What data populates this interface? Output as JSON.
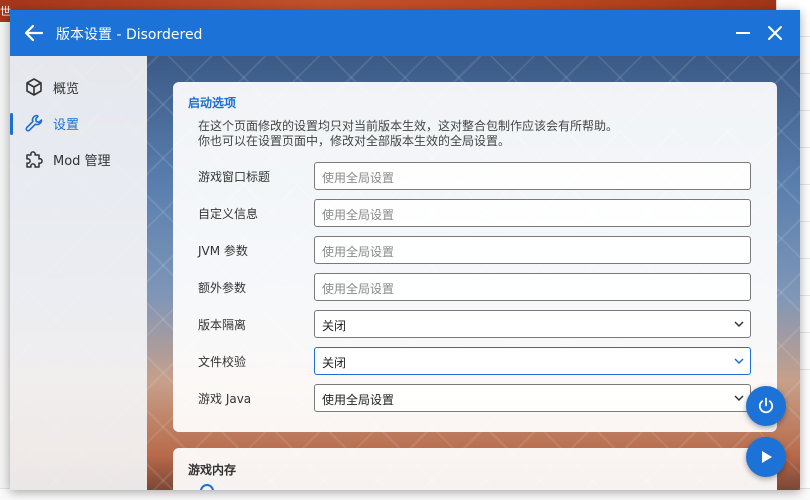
{
  "desktop": {
    "corner_text": "世"
  },
  "window": {
    "title": "版本设置 - Disordered",
    "accent_color": "#1c72d6"
  },
  "sidebar": {
    "items": [
      {
        "label": "概览",
        "icon": "cube-icon",
        "active": false
      },
      {
        "label": "设置",
        "icon": "wrench-icon",
        "active": true
      },
      {
        "label": "Mod 管理",
        "icon": "puzzle-icon",
        "active": false
      }
    ]
  },
  "launch_options": {
    "heading": "启动选项",
    "desc_line1": "在这个页面修改的设置均只对当前版本生效，这对整合包制作应该会有所帮助。",
    "desc_line2": "你也可以在设置页面中，修改对全部版本生效的全局设置。",
    "rows": [
      {
        "label": "游戏窗口标题",
        "placeholder": "使用全局设置",
        "type": "text"
      },
      {
        "label": "自定义信息",
        "placeholder": "使用全局设置",
        "type": "text"
      },
      {
        "label": "JVM 参数",
        "placeholder": "使用全局设置",
        "type": "text"
      },
      {
        "label": "额外参数",
        "placeholder": "使用全局设置",
        "type": "text"
      },
      {
        "label": "版本隔离",
        "value": "关闭",
        "type": "select"
      },
      {
        "label": "文件校验",
        "value": "关闭",
        "type": "select"
      },
      {
        "label": "游戏 Java",
        "value": "使用全局设置",
        "type": "select"
      }
    ]
  },
  "memory": {
    "heading": "游戏内存"
  },
  "fabs": {
    "power": "power-icon",
    "launch": "play-icon"
  }
}
